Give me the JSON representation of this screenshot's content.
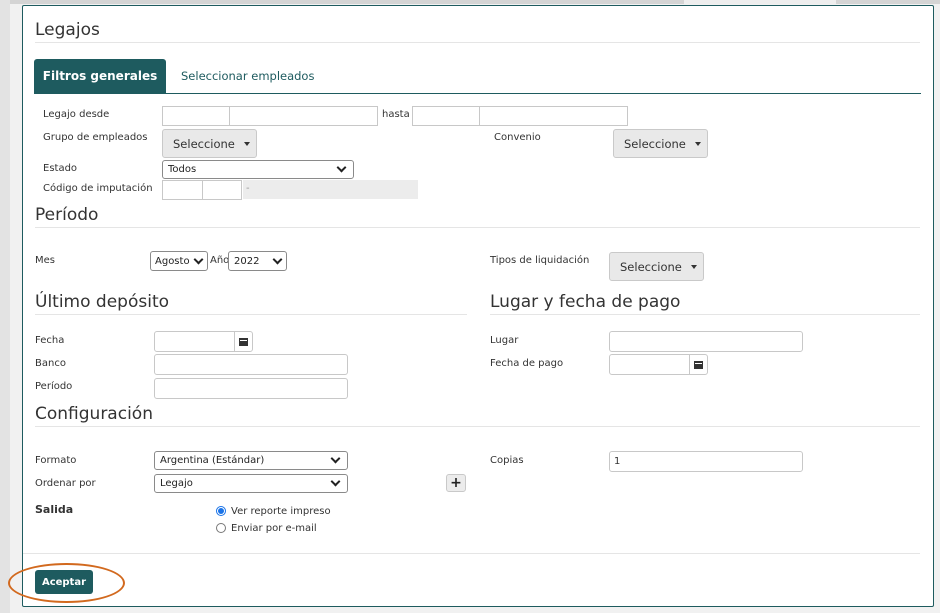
{
  "page": {
    "title": "Legajos",
    "tabs": [
      {
        "label": "Filtros generales",
        "active": true
      },
      {
        "label": "Seleccionar empleados",
        "active": false
      }
    ]
  },
  "filtros": {
    "legajo_desde_label": "Legajo desde",
    "hasta_label": "hasta",
    "grupo_label": "Grupo de empleados",
    "grupo_button": "Seleccione",
    "convenio_label": "Convenio",
    "convenio_button": "Seleccione",
    "estado_label": "Estado",
    "estado_value": "Todos",
    "codigo_label": "Código de imputación",
    "codigo_sep": "-"
  },
  "periodo": {
    "title": "Período",
    "mes_label": "Mes",
    "mes_value": "Agosto",
    "anio_label": "Año",
    "anio_value": "2022",
    "tipos_label": "Tipos de liquidación",
    "tipos_button": "Seleccione"
  },
  "deposito": {
    "title": "Último depósito",
    "fecha_label": "Fecha",
    "banco_label": "Banco",
    "periodo_label": "Período"
  },
  "pago": {
    "title": "Lugar y fecha de pago",
    "lugar_label": "Lugar",
    "fecha_label": "Fecha de pago"
  },
  "config": {
    "title": "Configuración",
    "formato_label": "Formato",
    "formato_value": "Argentina (Estándar)",
    "ordenar_label": "Ordenar por",
    "ordenar_value": "Legajo",
    "copias_label": "Copias",
    "copias_value": "1",
    "salida_label": "Salida",
    "salida_options": [
      "Ver reporte impreso",
      "Enviar por e-mail"
    ]
  },
  "actions": {
    "aceptar": "Aceptar"
  },
  "colors": {
    "accent": "#1e5b5f",
    "highlight": "#d2691e",
    "radio": "#1a73e8"
  }
}
